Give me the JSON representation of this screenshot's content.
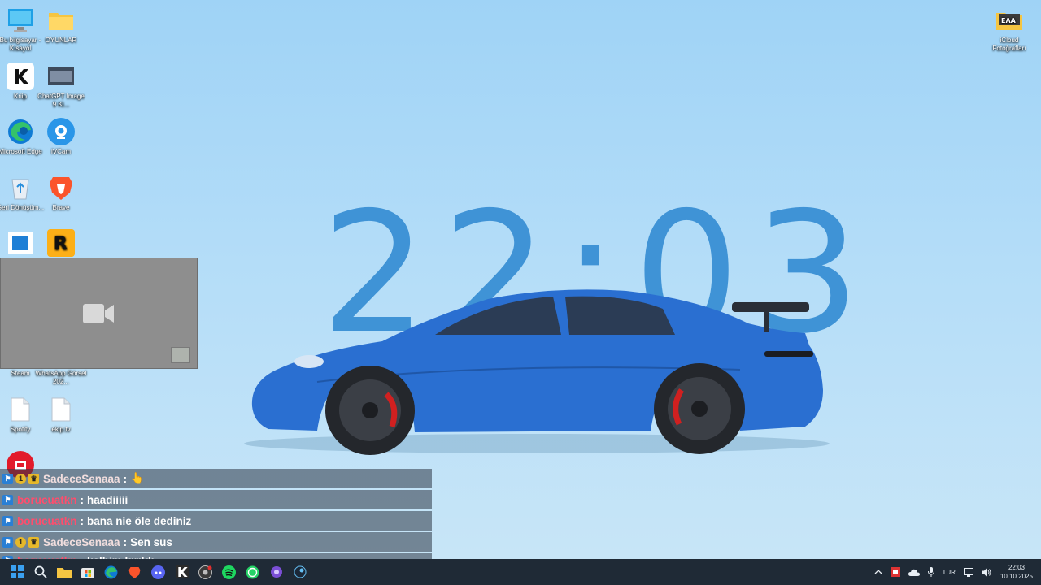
{
  "desktop": {
    "clock_text": "22:03",
    "icons": [
      {
        "id": "this-pc",
        "label": "Bu bilgisayar - Kısayol",
        "icon": "monitor-icon"
      },
      {
        "id": "oyunlar",
        "label": "OYUNLAR",
        "icon": "folder-icon"
      },
      {
        "id": "kriip",
        "label": "Kriip",
        "icon": "k-app-icon"
      },
      {
        "id": "chatgpt-image",
        "label": "ChatGPT Image 9 Ki...",
        "icon": "image-thumbnail-icon"
      },
      {
        "id": "edge",
        "label": "Microsoft Edge",
        "icon": "edge-icon"
      },
      {
        "id": "ivcam",
        "label": "iVCam",
        "icon": "webcam-icon"
      },
      {
        "id": "recycle-bin",
        "label": "Geri Dönüşüm...",
        "icon": "recycle-bin-icon"
      },
      {
        "id": "brave",
        "label": "Brave",
        "icon": "brave-lion-icon"
      },
      {
        "id": "blue-app",
        "label": "",
        "icon": "blue-window-icon"
      },
      {
        "id": "rockstar",
        "label": "",
        "icon": "rockstar-icon"
      },
      {
        "id": "steam",
        "label": "Steam",
        "icon": "steam-icon"
      },
      {
        "id": "whatsapp-image",
        "label": "WhatsApp Görsel 202...",
        "icon": "image-file-icon"
      },
      {
        "id": "spotify-file",
        "label": "Spotify",
        "icon": "file-icon"
      },
      {
        "id": "ekiptv",
        "label": "ekip.tv",
        "icon": "file-icon"
      },
      {
        "id": "icloud",
        "label": "iCloud Fotoğrafları",
        "icon": "icloud-photos-icon"
      },
      {
        "id": "red-app",
        "label": "",
        "icon": "red-app-icon"
      }
    ]
  },
  "camera_overlay": {
    "icon": "video-camera-icon"
  },
  "chat": {
    "messages": [
      {
        "user": "SadeceSenaaa",
        "text": "👆",
        "user_color": "#f2dede",
        "badges": [
          "pin",
          "1",
          "crown"
        ]
      },
      {
        "user": "borucuatkn",
        "text": "haadiiiii",
        "user_color": "#ff4d6d",
        "badges": [
          "pin"
        ]
      },
      {
        "user": "borucuatkn",
        "text": "bana nie öle dediniz",
        "user_color": "#ff4d6d",
        "badges": [
          "pin"
        ]
      },
      {
        "user": "SadeceSenaaa",
        "text": "Sen sus",
        "user_color": "#f2dede",
        "badges": [
          "pin",
          "1",
          "crown"
        ]
      },
      {
        "user": "borucuatkn",
        "text": "kalbim kırıldı",
        "user_color": "#ff4d6d",
        "badges": [
          "pin"
        ]
      }
    ],
    "separator": ":"
  },
  "taskbar": {
    "apps": [
      "windows-start-icon",
      "search-icon",
      "file-explorer-icon",
      "store-icon",
      "edge-icon",
      "brave-icon",
      "discord-icon",
      "kick-icon",
      "obs-icon",
      "spotify-icon",
      "whatsapp-icon",
      "app-icon",
      "steam-icon"
    ],
    "tray": {
      "language": "TUR",
      "time": "22:03",
      "date": "10.10.2025"
    }
  },
  "colors": {
    "accent": "#3f93d6",
    "taskbar": "#1f2a36",
    "car": "#2a6fd1"
  }
}
